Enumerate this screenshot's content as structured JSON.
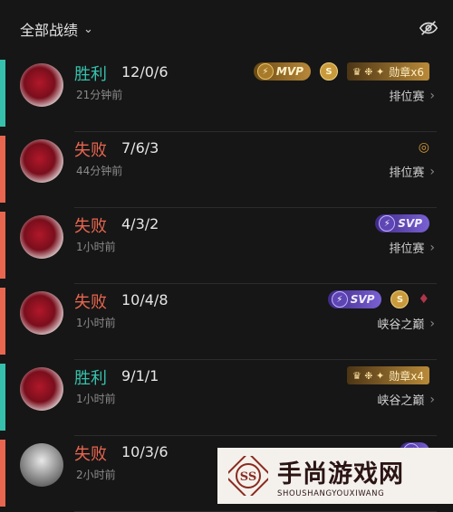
{
  "header": {
    "filter_label": "全部战绩",
    "chevron_icon": "chevron-down-icon",
    "visibility_icon": "eye-off-icon"
  },
  "colors": {
    "win": "#36c1ac",
    "loss": "#e8664f",
    "background": "#161616"
  },
  "matches": [
    {
      "result": "胜利",
      "outcome": "win",
      "kda": "12/0/6",
      "time": "21分钟前",
      "mode": "排位赛",
      "badges": [
        {
          "type": "gold",
          "label": "MVP"
        },
        {
          "type": "coin",
          "label": "S"
        },
        {
          "type": "medal",
          "label": "勋章x6"
        }
      ]
    },
    {
      "result": "失败",
      "outcome": "loss",
      "kda": "7/6/3",
      "time": "44分钟前",
      "mode": "排位赛",
      "badges": [
        {
          "type": "icon",
          "label": "coins-icon"
        }
      ]
    },
    {
      "result": "失败",
      "outcome": "loss",
      "kda": "4/3/2",
      "time": "1小时前",
      "mode": "排位赛",
      "badges": [
        {
          "type": "purple",
          "label": "SVP"
        }
      ]
    },
    {
      "result": "失败",
      "outcome": "loss",
      "kda": "10/4/8",
      "time": "1小时前",
      "mode": "峡谷之巅",
      "badges": [
        {
          "type": "purple",
          "label": "SVP"
        },
        {
          "type": "coin",
          "label": "S"
        },
        {
          "type": "icon",
          "label": "demon-icon"
        }
      ]
    },
    {
      "result": "胜利",
      "outcome": "win",
      "kda": "9/1/1",
      "time": "1小时前",
      "mode": "峡谷之巅",
      "badges": [
        {
          "type": "medal",
          "label": "勋章x4"
        }
      ]
    },
    {
      "result": "失败",
      "outcome": "loss",
      "kda": "10/3/6",
      "time": "2小时前",
      "mode": "",
      "badges": [
        {
          "type": "purple",
          "label": ""
        }
      ]
    }
  ],
  "watermark": {
    "title": "手尚游戏网",
    "subtitle": "SHOUSHANGYOUXIWANG",
    "seal": "SS"
  }
}
